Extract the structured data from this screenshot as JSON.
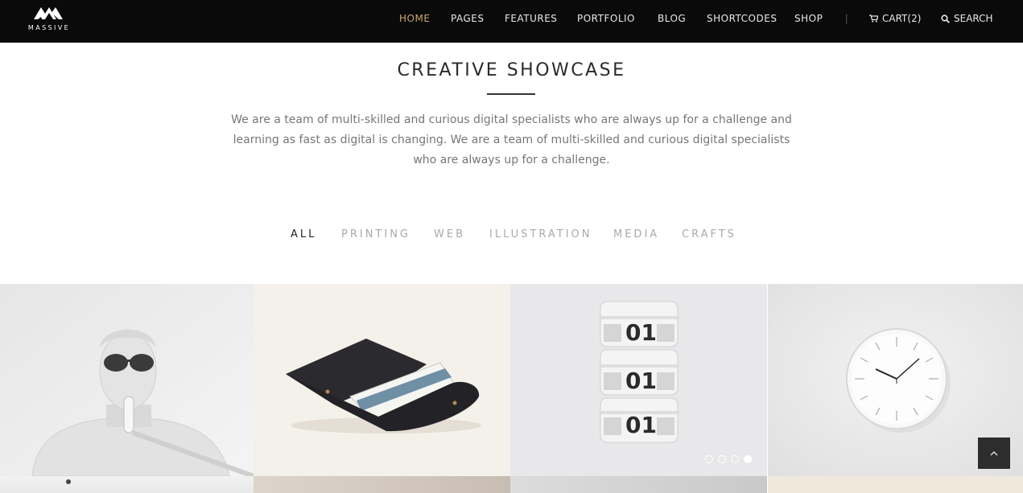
{
  "header": {
    "logo_text": "MASSIVE",
    "nav": [
      "HOME",
      "PAGES",
      "FEATURES",
      "PORTFOLIO",
      "BLOG",
      "SHORTCODES",
      "SHOP"
    ],
    "separator": "|",
    "cart_label": "CART(2)",
    "search_label": "SEARCH",
    "active_color": "#c9a96a"
  },
  "section": {
    "title": "CREATIVE SHOWCASE",
    "intro": "We are a team of multi-skilled and curious digital specialists who are always up for a challenge and learning as fast as digital is changing. We are a team of multi-skilled and curious digital specialists who are always up for a challenge."
  },
  "filters": [
    "ALL",
    "PRINTING",
    "WEB",
    "ILLUSTRATION",
    "MEDIA",
    "CRAFTS"
  ],
  "gallery": {
    "stack_label": "01",
    "slider_active_index": 4,
    "slider_count": 4
  },
  "icons": {
    "cart": "cart-icon",
    "search": "search-icon",
    "back_to_top": "chevron-up-icon"
  }
}
